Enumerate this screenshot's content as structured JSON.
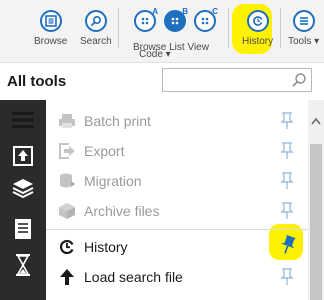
{
  "toolbar": {
    "browse_label": "Browse",
    "search_label": "Search",
    "browse_list_view_label": "Browse List View",
    "code_label": "Code ▾",
    "history_label": "History",
    "tools_label": "Tools ▾",
    "superscripts": {
      "a": "A",
      "b": "B",
      "c": "C"
    }
  },
  "header": {
    "title": "All tools",
    "search_value": "",
    "search_placeholder": ""
  },
  "tools": [
    {
      "label": "Batch print",
      "icon": "printer-icon",
      "enabled": false,
      "pinned": false
    },
    {
      "label": "Export",
      "icon": "export-icon",
      "enabled": false,
      "pinned": false
    },
    {
      "label": "Migration",
      "icon": "migration-icon",
      "enabled": false,
      "pinned": false
    },
    {
      "label": "Archive files",
      "icon": "archive-box-icon",
      "enabled": false,
      "pinned": false
    },
    {
      "label": "History",
      "icon": "history-icon",
      "enabled": true,
      "pinned": true
    },
    {
      "label": "Load search file",
      "icon": "arrow-up-icon",
      "enabled": true,
      "pinned": false
    }
  ],
  "rail": [
    "menu-icon",
    "upload-icon",
    "layers-icon",
    "document-icon",
    "hourglass-icon"
  ],
  "colors": {
    "accent": "#1f6fbf",
    "highlight": "#fff200",
    "rail": "#2b2b2b",
    "disabled_text": "#9a9a9a",
    "pin_inactive": "#8fb3d9"
  }
}
